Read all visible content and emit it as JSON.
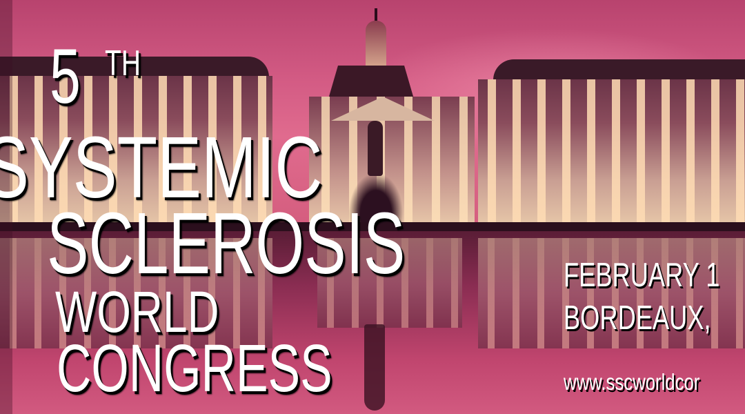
{
  "banner": {
    "edition_number": "5",
    "edition_suffix": "TH",
    "title_lines": [
      "SYSTEMIC",
      "SCLEROSIS",
      "WORLD",
      "CONGRESS"
    ],
    "date_text": "FEBRUARY 1",
    "location_text": "BORDEAUX,",
    "website_text": "www.sscworldcor"
  },
  "colors": {
    "text": "#ffffff",
    "text_shadow": "#000000",
    "sky": "#d35b84",
    "water": "#c0456e"
  }
}
